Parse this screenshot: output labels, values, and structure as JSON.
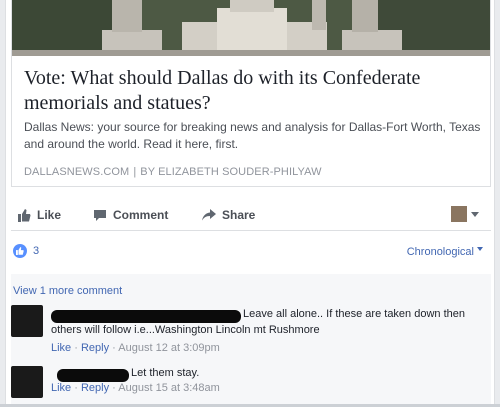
{
  "post": {
    "headline": "Vote: What should Dallas do with its Confederate memorials and statues?",
    "description": "Dallas News: your source for breaking news and analysis for Dallas-Fort Worth, Texas and around the world. Read it here, first.",
    "source_domain": "DALLASNEWS.COM",
    "source_separator": "|",
    "byline": "BY ELIZABETH SOUDER-PHILYAW"
  },
  "actions": {
    "like": "Like",
    "comment": "Comment",
    "share": "Share"
  },
  "reactions": {
    "count": "3",
    "sort": "Chronological"
  },
  "comments": {
    "view_more": "View 1 more comment",
    "items": [
      {
        "text_line1": "Leave all alone.. If these are taken down then",
        "text_line2": "others will follow i.e...Washington Lincoln mt Rushmore",
        "like": "Like",
        "dot1": "·",
        "reply": "Reply",
        "dot2": "·",
        "time": "August 12 at 3:09pm"
      },
      {
        "text_line1": "Let them stay.",
        "like": "Like",
        "dot1": "·",
        "reply": "Reply",
        "dot2": "·",
        "time": "August 15 at 3:48am"
      }
    ]
  },
  "colors": {
    "link_blue": "#4267b2",
    "like_blue": "#5890ff",
    "meta_gray": "#90949c",
    "text_dark": "#1d2129"
  }
}
